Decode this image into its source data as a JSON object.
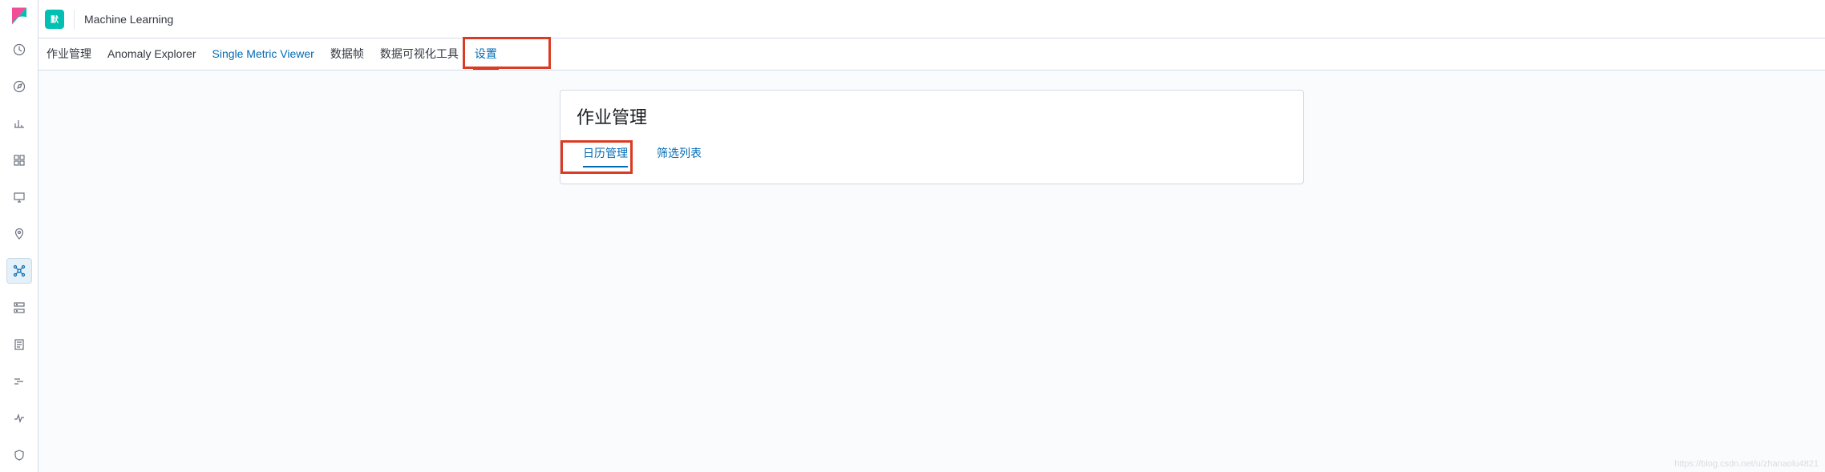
{
  "header": {
    "badge": "默",
    "title": "Machine Learning"
  },
  "tabs": [
    {
      "label": "作业管理",
      "active": false,
      "blue": false
    },
    {
      "label": "Anomaly Explorer",
      "active": false,
      "blue": false
    },
    {
      "label": "Single Metric Viewer",
      "active": false,
      "blue": true
    },
    {
      "label": "数据帧",
      "active": false,
      "blue": false
    },
    {
      "label": "数据可视化工具",
      "active": false,
      "blue": false
    },
    {
      "label": "设置",
      "active": true,
      "blue": true
    }
  ],
  "card": {
    "title": "作业管理",
    "tabs": [
      {
        "label": "日历管理",
        "active": true
      },
      {
        "label": "筛选列表",
        "active": false
      }
    ]
  },
  "sidebar_icons": [
    "recent-icon",
    "discover-icon",
    "visualize-icon",
    "dashboard-icon",
    "canvas-icon",
    "maps-icon",
    "ml-icon",
    "infra-icon",
    "logs-icon",
    "apm-icon",
    "uptime-icon",
    "siem-icon"
  ],
  "watermark": "https://blog.csdn.net/u/zhanaolu4821"
}
